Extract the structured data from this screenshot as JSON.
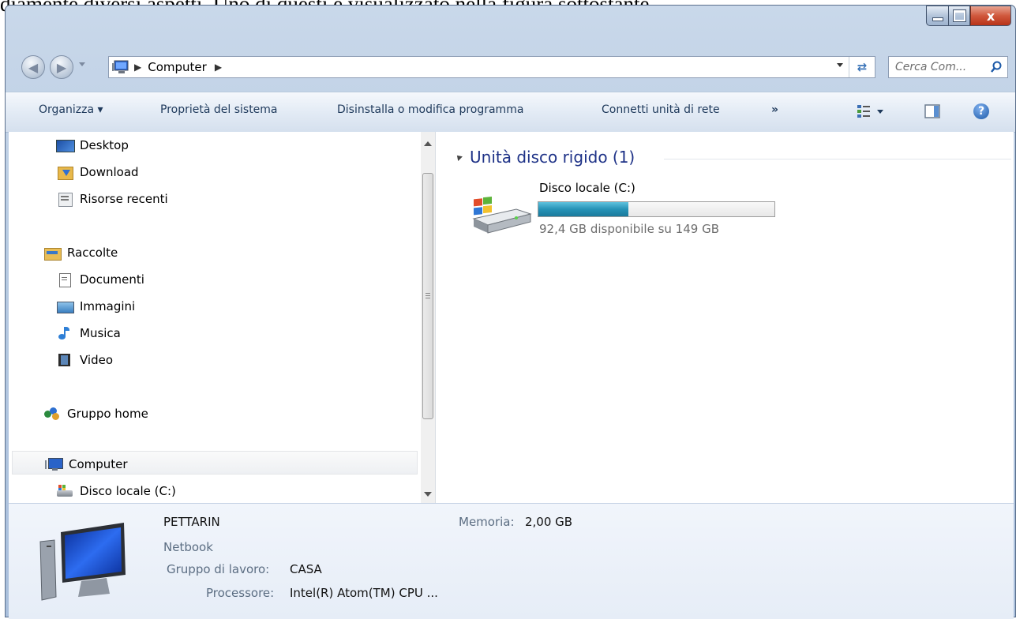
{
  "document_text": "diamente diversi aspetti. Uno di questi è visualizzato nella figura sottostante.",
  "window": {
    "controls": {
      "minimize": "–",
      "maximize": "□",
      "close": "x"
    }
  },
  "address_bar": {
    "breadcrumb": "Computer",
    "search_placeholder": "Cerca Com..."
  },
  "toolbar": {
    "organize": "Organizza ▾",
    "system_properties": "Proprietà del sistema",
    "uninstall": "Disinstalla o modifica programma",
    "map_drive": "Connetti unità di rete",
    "more": "»"
  },
  "navigation": {
    "favorites": [
      "Desktop",
      "Download",
      "Risorse recenti"
    ],
    "libraries_header": "Raccolte",
    "libraries": [
      "Documenti",
      "Immagini",
      "Musica",
      "Video"
    ],
    "homegroup": "Gruppo home",
    "computer": "Computer",
    "local_disk": "Disco locale (C:)"
  },
  "main": {
    "group_title": "Unità disco rigido (1)",
    "drive": {
      "name": "Disco locale (C:)",
      "summary": "92,4 GB disponibile su 149 GB",
      "used_fraction": 0.38
    }
  },
  "details": {
    "computer_name": "PETTARIN",
    "model": "Netbook",
    "workgroup_label": "Gruppo di lavoro:",
    "workgroup_value": "CASA",
    "processor_label": "Processore:",
    "processor_value": "Intel(R) Atom(TM) CPU ...",
    "memory_label": "Memoria:",
    "memory_value": "2,00 GB"
  },
  "colors": {
    "accent": "#1e3287",
    "progress_fill": "#2592b6"
  }
}
